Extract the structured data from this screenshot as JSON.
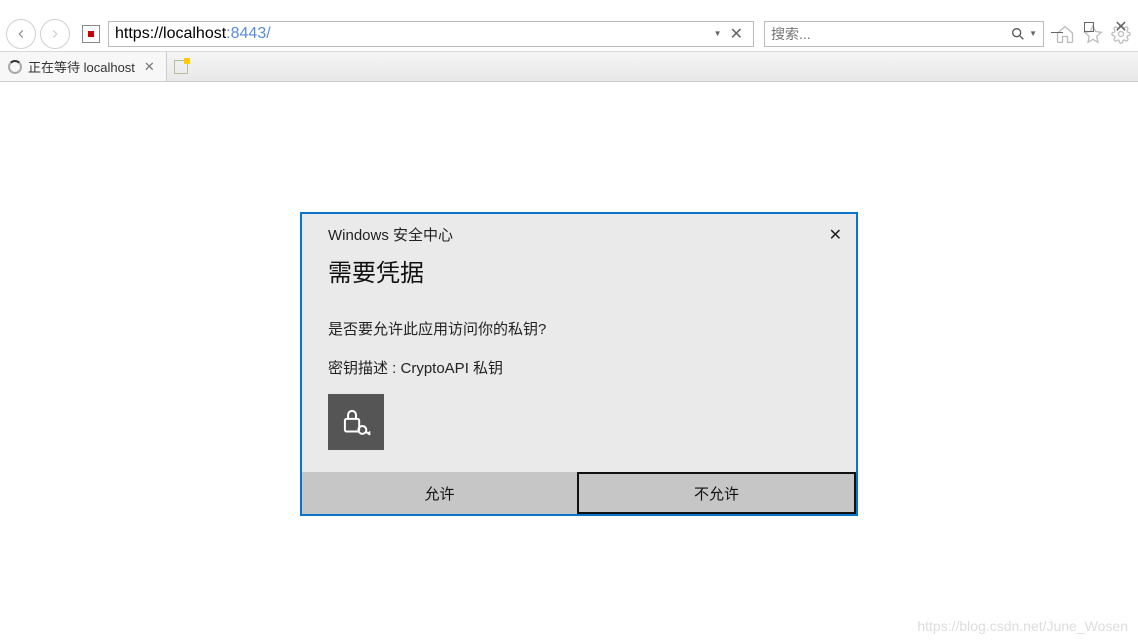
{
  "window_controls": {
    "minimize": "—",
    "maximize": "☐",
    "close": "✕"
  },
  "toolbar": {
    "url_prefix": "https://localhost",
    "url_port": ":8443/",
    "search_placeholder": "搜索..."
  },
  "tab": {
    "label": "正在等待 localhost"
  },
  "dialog": {
    "caption": "Windows 安全中心",
    "title": "需要凭据",
    "message": "是否要允许此应用访问你的私钥?",
    "desc": "密钥描述 : CryptoAPI 私钥",
    "allow": "允许",
    "deny": "不允许"
  },
  "watermark": "https://blog.csdn.net/June_Wosen"
}
